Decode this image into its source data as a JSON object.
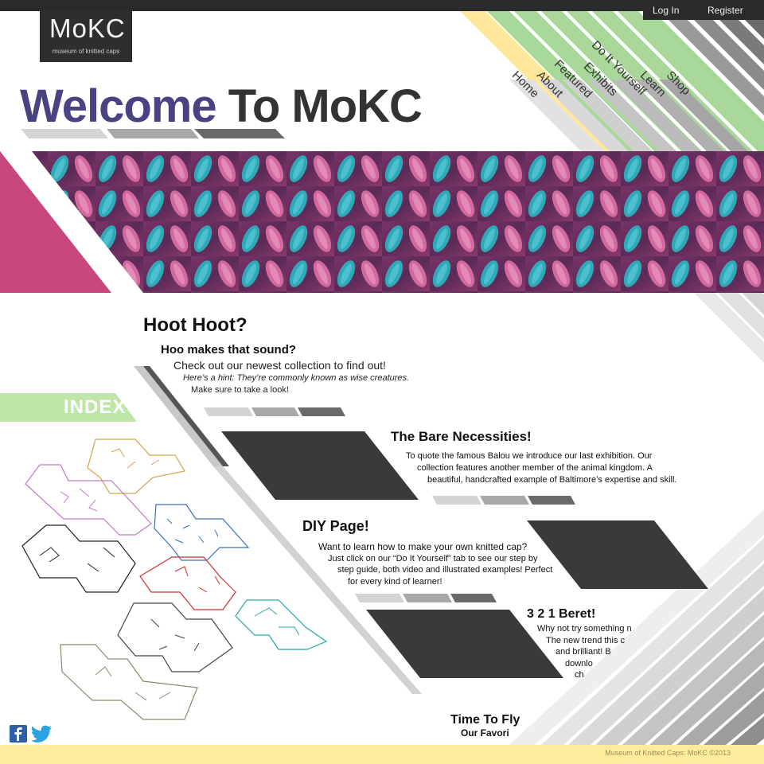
{
  "auth": {
    "login": "Log In",
    "register": "Register"
  },
  "logo": {
    "mark": "MoKC",
    "subtitle": "museum of knitted caps"
  },
  "welcome": {
    "first": "Welcome",
    "rest": "To MoKC"
  },
  "nav": [
    "Home",
    "About",
    "Featured",
    "Exhibits",
    "Do It Yourself",
    "Learn",
    "Shop"
  ],
  "index_label": "INDEX",
  "hoot": {
    "title": "Hoot Hoot?",
    "subtitle": "Hoo makes that sound?",
    "line1": "Check out our newest collection to find out!",
    "hint": "Here’s a hint:  They’re commonly known as wise creatures.",
    "line3": "Make sure to take a look!"
  },
  "bare": {
    "title": "The Bare Necessities!",
    "l1": "To quote the famous Balou we introduce our last exhibition.  Our",
    "l2": "collection features another member of the animal kingdom. A",
    "l3": "beautiful, handcrafted example of Baltimore’s  expertise and skill."
  },
  "diy": {
    "title": "DIY Page!",
    "l1": "Want to learn how to make your own knitted cap?",
    "l2": "Just click on our “Do It Yourself” tab to see our step by",
    "l3": "step guide, both video and illustrated  examples! Perfect",
    "l4": "for every kind of learner!"
  },
  "beret": {
    "title": "3 2 1 Beret!",
    "l1": "Why not try something n",
    "l2": "The new trend this c",
    "l3": "and brilliant! B",
    "l4": "downlo",
    "l5": "ch"
  },
  "fly": {
    "title": "Time To Fly",
    "l1": "Our Favori"
  },
  "footer": {
    "copyright": "Museum of Knitted Caps: MoKC ©2013"
  },
  "colors": {
    "dark": "#2a2a2a",
    "purple": "#4a4383",
    "green": "#a8d79a",
    "yellow": "#ffe89a",
    "pink": "#c8477d",
    "teal": "#2fa8b8"
  },
  "icons": [
    "facebook-icon",
    "twitter-icon"
  ]
}
